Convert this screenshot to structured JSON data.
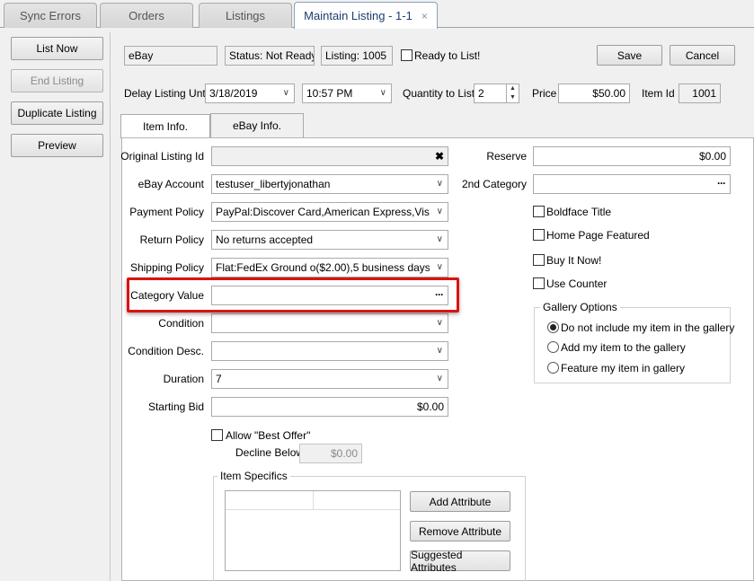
{
  "tabs": [
    {
      "label": "Sync Errors"
    },
    {
      "label": "Orders"
    },
    {
      "label": "Listings"
    },
    {
      "label": "Maintain Listing - 1-1",
      "close": "×"
    }
  ],
  "left_buttons": {
    "list_now": "List Now",
    "end_listing": "End Listing",
    "duplicate_listing": "Duplicate Listing",
    "preview": "Preview"
  },
  "header": {
    "channel": "eBay",
    "status": "Status: Not Ready",
    "listing": "Listing: 1005",
    "ready_label": "Ready to List!",
    "save": "Save",
    "cancel": "Cancel",
    "delay_label": "Delay Listing Until",
    "delay_date": "3/18/2019",
    "delay_time": "10:57 PM",
    "qty_label": "Quantity to List",
    "qty_value": "2",
    "price_label": "Price",
    "price_value": "$50.00",
    "item_id_label": "Item Id",
    "item_id_value": "1001"
  },
  "subtabs": {
    "item_info": "Item Info.",
    "ebay_info": "eBay Info."
  },
  "form": {
    "original_listing_label": "Original Listing Id",
    "original_listing_value": "",
    "ebay_account_label": "eBay Account",
    "ebay_account_value": "testuser_libertyjonathan",
    "payment_label": "Payment Policy",
    "payment_value": "PayPal:Discover Card,American Express,Visa or",
    "return_label": "Return Policy",
    "return_value": "No returns accepted",
    "shipping_label": "Shipping Policy",
    "shipping_value": "Flat:FedEx Ground o($2.00),5 business days",
    "category_label": "Category Value",
    "category_value": "",
    "condition_label": "Condition",
    "condition_value": "",
    "condition_desc_label": "Condition Desc.",
    "condition_desc_value": "",
    "duration_label": "Duration",
    "duration_value": "7",
    "starting_bid_label": "Starting Bid",
    "starting_bid_value": "$0.00",
    "best_offer_label": "Allow \"Best Offer\"",
    "decline_label": "Decline Below",
    "decline_value": "$0.00",
    "reserve_label": "Reserve",
    "reserve_value": "$0.00",
    "second_category_label": "2nd Category",
    "boldface": "Boldface Title",
    "home_featured": "Home Page Featured",
    "buy_it_now": "Buy It Now!",
    "use_counter": "Use Counter",
    "gallery_title": "Gallery Options",
    "gallery_options": [
      "Do not include my item in the gallery",
      "Add my item to the gallery",
      "Feature my item in gallery"
    ],
    "item_specifics_title": "Item Specifics",
    "add_attribute": "Add Attribute",
    "remove_attribute": "Remove Attribute",
    "suggested_attributes": "Suggested Attributes"
  },
  "icons": {
    "clear": "✖",
    "ellipsis": "···",
    "chevron": "∨"
  }
}
